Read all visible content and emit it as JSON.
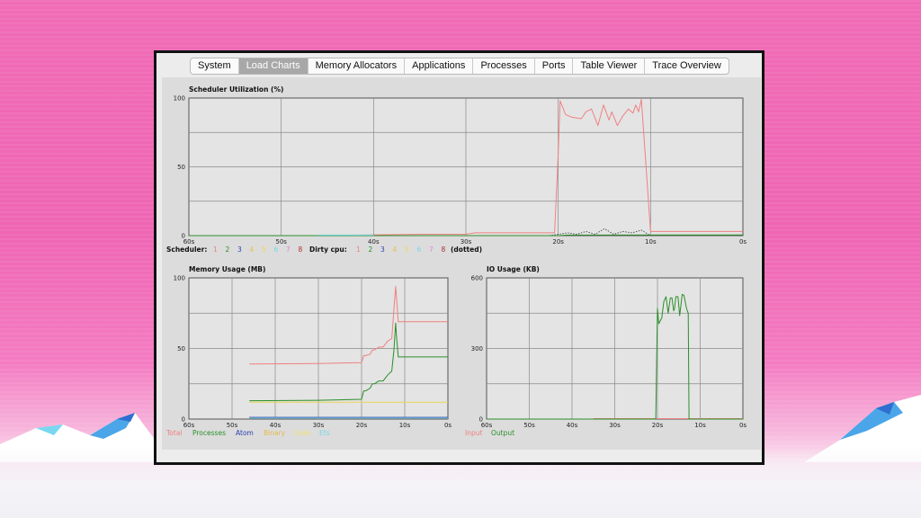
{
  "tabs": [
    {
      "label": "System",
      "active": false
    },
    {
      "label": "Load Charts",
      "active": true
    },
    {
      "label": "Memory Allocators",
      "active": false
    },
    {
      "label": "Applications",
      "active": false
    },
    {
      "label": "Processes",
      "active": false
    },
    {
      "label": "Ports",
      "active": false
    },
    {
      "label": "Table Viewer",
      "active": false
    },
    {
      "label": "Trace Overview",
      "active": false
    }
  ],
  "chart_data": [
    {
      "type": "line",
      "title": "Scheduler Utilization (%)",
      "ylim": [
        0,
        100
      ],
      "y_ticks": [
        "100",
        "50",
        "0"
      ],
      "x_ticks": [
        "60s",
        "50s",
        "40s",
        "30s",
        "20s",
        "10s",
        "0s"
      ],
      "legend": {
        "scheduler_label": "Scheduler:",
        "scheduler_items": [
          "1",
          "2",
          "3",
          "4",
          "5",
          "6",
          "7",
          "8"
        ],
        "dirty_label": "Dirty cpu:",
        "dirty_items": [
          "1",
          "2",
          "3",
          "4",
          "5",
          "6",
          "7",
          "8"
        ],
        "dirty_note": "(dotted)"
      },
      "series": [
        {
          "name": "1",
          "color": "#f08080",
          "x": [
            -46,
            -35,
            -30,
            -29,
            -28,
            -20.4,
            -20,
            -19.8,
            -19.2,
            -18.5,
            -17.5,
            -17,
            -16.4,
            -15.7,
            -15.1,
            -14.5,
            -14.2,
            -13.6,
            -13,
            -12.4,
            -11.9,
            -11.6,
            -11.3,
            -11,
            -10,
            -8,
            -5,
            0
          ],
          "y": [
            0,
            1,
            1,
            2,
            2,
            2,
            60,
            98,
            88,
            86,
            85,
            90,
            92,
            80,
            95,
            84,
            90,
            80,
            87,
            92,
            89,
            95,
            90,
            99,
            3,
            3,
            3,
            3
          ]
        },
        {
          "name": "dirty cpu",
          "color": "#555555",
          "dotted": true,
          "x": [
            -21,
            -20,
            -19,
            -18,
            -17,
            -16,
            -15,
            -14,
            -13,
            -12,
            -11,
            -10
          ],
          "y": [
            0,
            1,
            2,
            1,
            3,
            1,
            5,
            1,
            3,
            2,
            4,
            0
          ]
        },
        {
          "name": "2",
          "color": "#2a8f2a",
          "x": [
            -60,
            -20,
            -19,
            0
          ],
          "y": [
            0,
            0,
            0.4,
            0.5
          ]
        },
        {
          "name": "6",
          "color": "#7ad7e6",
          "x": [
            -46,
            -40
          ],
          "y": [
            0.4,
            0.4
          ]
        }
      ]
    },
    {
      "type": "line",
      "title": "Memory Usage (MB)",
      "ylim": [
        0,
        100
      ],
      "y_ticks": [
        "100",
        "50",
        "0"
      ],
      "x_ticks": [
        "60s",
        "50s",
        "40s",
        "30s",
        "20s",
        "10s",
        "0s"
      ],
      "legend": [
        "Total",
        "Processes",
        "Atom",
        "Binary",
        "Code",
        "Ets"
      ],
      "series": [
        {
          "name": "Total",
          "color": "#f08080",
          "x": [
            -46,
            -30,
            -20,
            -19.5,
            -19,
            -18,
            -17.5,
            -17,
            -16,
            -15,
            -14,
            -13,
            -12.5,
            -12.1,
            -11.9,
            -11.5,
            -11,
            0
          ],
          "y": [
            39,
            39.3,
            40,
            45,
            45,
            46,
            49,
            49,
            51,
            51,
            55,
            57,
            78,
            94,
            85,
            69,
            69,
            69
          ]
        },
        {
          "name": "Processes",
          "color": "#2a8f2a",
          "x": [
            -46,
            -30,
            -20,
            -19.5,
            -19,
            -18,
            -17.5,
            -17,
            -16,
            -15,
            -14,
            -13,
            -12.5,
            -12.1,
            -11.9,
            -11.5,
            -11,
            0
          ],
          "y": [
            13,
            13.3,
            14,
            20,
            20,
            22,
            25,
            25,
            27,
            27,
            31,
            34,
            49,
            68,
            58,
            44,
            44,
            44
          ]
        },
        {
          "name": "Binary",
          "color": "#e8d45a",
          "x": [
            -46,
            0
          ],
          "y": [
            12,
            12
          ]
        },
        {
          "name": "Atom",
          "color": "#2c3fb0",
          "x": [
            -46,
            0
          ],
          "y": [
            1.2,
            1.2
          ]
        },
        {
          "name": "Ets",
          "color": "#7ad7e6",
          "x": [
            -46,
            0
          ],
          "y": [
            0.7,
            0.7
          ]
        }
      ]
    },
    {
      "type": "line",
      "title": "IO Usage (KB)",
      "ylim": [
        0,
        600
      ],
      "y_ticks": [
        "600",
        "300",
        "0"
      ],
      "x_ticks": [
        "60s",
        "50s",
        "40s",
        "30s",
        "20s",
        "10s",
        "0s"
      ],
      "legend": [
        "Input",
        "Output"
      ],
      "series": [
        {
          "name": "Input",
          "color": "#f08080",
          "x": [
            -35,
            0
          ],
          "y": [
            2,
            2
          ]
        },
        {
          "name": "Output",
          "color": "#2a8f2a",
          "x": [
            -60,
            -20.4,
            -20,
            -19.7,
            -19,
            -18.5,
            -18,
            -17.5,
            -17,
            -16.6,
            -16.2,
            -16,
            -15.7,
            -15.2,
            -14.8,
            -14.2,
            -13.8,
            -13.2,
            -12.8,
            -12.6,
            0
          ],
          "y": [
            0,
            0,
            470,
            405,
            430,
            500,
            520,
            450,
            515,
            515,
            460,
            470,
            520,
            520,
            440,
            530,
            525,
            470,
            450,
            0,
            0
          ]
        }
      ]
    }
  ]
}
